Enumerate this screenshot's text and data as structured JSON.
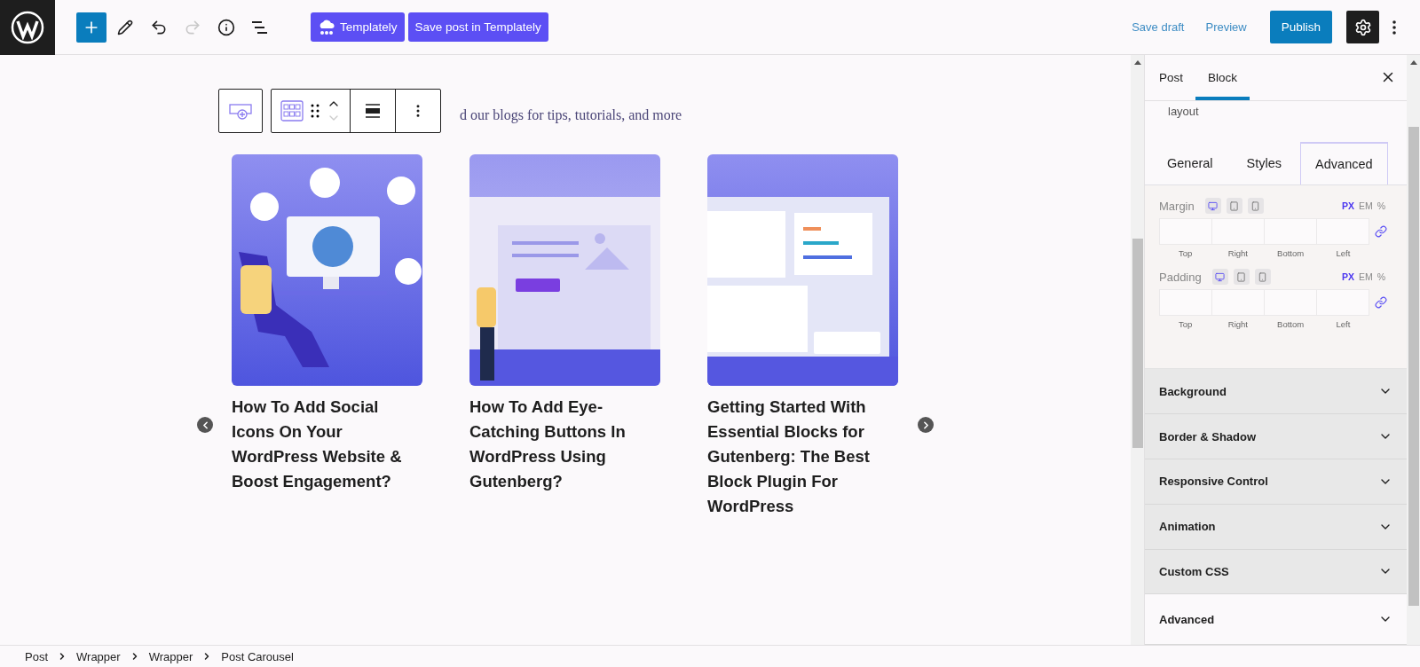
{
  "top_bar": {
    "undo_disabled": false,
    "redo_disabled": true,
    "templately_buttons": [
      "Templately",
      "Save post in Templately"
    ],
    "save_draft": "Save draft",
    "preview": "Preview",
    "publish": "Publish",
    "settings_active": true
  },
  "canvas": {
    "subtitle": "d our blogs for tips, tutorials, and more",
    "posts": [
      {
        "title": "How To Add Social Icons On Your WordPress Website & Boost Engagement?",
        "kind": "social"
      },
      {
        "title": "How To Add Eye-Catching Buttons In WordPress Using Gutenberg?",
        "kind": "button"
      },
      {
        "title": "Getting Started With Essential Blocks for Gutenberg: The Best Block Plugin For WordPress",
        "kind": "blocks"
      }
    ]
  },
  "sidebar": {
    "tabs": [
      {
        "label": "Post",
        "selected": false
      },
      {
        "label": "Block",
        "selected": true
      }
    ],
    "description": "layout",
    "inner_tabs": [
      {
        "label": "General",
        "selected": false
      },
      {
        "label": "Styles",
        "selected": false
      },
      {
        "label": "Advanced",
        "selected": true
      }
    ],
    "spacing": [
      {
        "label": "Margin",
        "devices": [
          {
            "kind": "desktop",
            "selected": true
          },
          {
            "kind": "tablet",
            "selected": false
          },
          {
            "kind": "mobile",
            "selected": false
          }
        ],
        "units": [
          {
            "label": "PX",
            "selected": true
          },
          {
            "label": "EM",
            "selected": false
          },
          {
            "label": "%",
            "selected": false
          }
        ],
        "sides": [
          "Top",
          "Right",
          "Bottom",
          "Left"
        ]
      },
      {
        "label": "Padding",
        "devices": [
          {
            "kind": "desktop",
            "selected": true
          },
          {
            "kind": "tablet",
            "selected": false
          },
          {
            "kind": "mobile",
            "selected": false
          }
        ],
        "units": [
          {
            "label": "PX",
            "selected": true
          },
          {
            "label": "EM",
            "selected": false
          },
          {
            "label": "%",
            "selected": false
          }
        ],
        "sides": [
          "Top",
          "Right",
          "Bottom",
          "Left"
        ]
      }
    ],
    "panels": [
      {
        "label": "Background",
        "kind": "plugin",
        "expanded": false
      },
      {
        "label": "Border & Shadow",
        "kind": "plugin",
        "expanded": false
      },
      {
        "label": "Responsive Control",
        "kind": "plugin",
        "expanded": false
      },
      {
        "label": "Animation",
        "kind": "plugin",
        "expanded": false
      },
      {
        "label": "Custom CSS",
        "kind": "plugin",
        "expanded": false
      },
      {
        "label": "Advanced",
        "kind": "core",
        "expanded": false
      }
    ]
  },
  "breadcrumb": [
    "Post",
    "Wrapper",
    "Wrapper",
    "Post Carousel"
  ]
}
